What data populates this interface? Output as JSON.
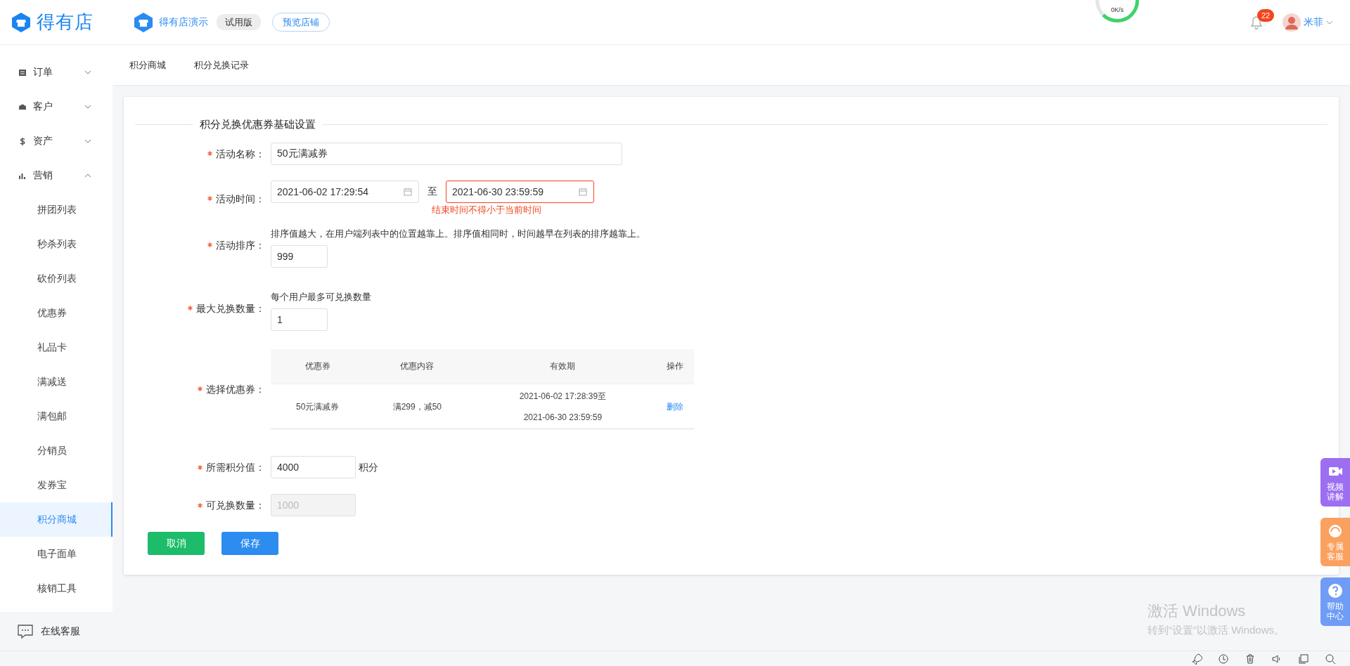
{
  "header": {
    "logo_text": "得有店",
    "store_name": "得有店演示",
    "plan_badge": "试用版",
    "preview_button": "预览店铺",
    "speed": "0K/s",
    "notifications": "22",
    "user": "米菲"
  },
  "tabs": [
    {
      "label": "积分商城"
    },
    {
      "label": "积分兑换记录"
    }
  ],
  "sidebar": {
    "items": [
      {
        "label": "订单",
        "expanded": false
      },
      {
        "label": "客户",
        "expanded": false
      },
      {
        "label": "资产",
        "expanded": false
      },
      {
        "label": "营销",
        "expanded": true,
        "children": [
          {
            "label": "拼团列表",
            "selected": false
          },
          {
            "label": "秒杀列表",
            "selected": false
          },
          {
            "label": "砍价列表",
            "selected": false
          },
          {
            "label": "优惠券",
            "selected": false
          },
          {
            "label": "礼品卡",
            "selected": false
          },
          {
            "label": "满减送",
            "selected": false
          },
          {
            "label": "满包邮",
            "selected": false
          },
          {
            "label": "分销员",
            "selected": false
          },
          {
            "label": "发券宝",
            "selected": false
          },
          {
            "label": "积分商城",
            "selected": true
          },
          {
            "label": "电子面单",
            "selected": false
          },
          {
            "label": "核销工具",
            "selected": false
          }
        ]
      }
    ],
    "support": "在线客服"
  },
  "form": {
    "section_title": "积分兑换优惠券基础设置",
    "fields": [
      {
        "kind": "text",
        "label": "活动名称：",
        "required": true,
        "value": "50元满减券"
      },
      {
        "kind": "daterange",
        "label": "活动时间：",
        "required": true,
        "start": "2021-06-02 17:29:54",
        "separator": "至",
        "end": "2021-06-30 23:59:59",
        "error": "结束时间不得小于当前时间"
      },
      {
        "kind": "hinted",
        "label": "活动排序：",
        "required": true,
        "hint": "排序值越大，在用户端列表中的位置越靠上。排序值相同时，时间越早在列表的排序越靠上。",
        "value": "999"
      },
      {
        "kind": "hinted",
        "label": "最大兑换数量：",
        "required": true,
        "hint": "每个用户最多可兑换数量",
        "value": "1"
      },
      {
        "kind": "table",
        "label": "选择优惠券：",
        "required": true,
        "columns": [
          "优惠券",
          "优惠内容",
          "有效期",
          "操作"
        ],
        "rows": [
          {
            "coupon": "50元满减券",
            "content": "满299，减50",
            "validity": [
              "2021-06-02 17:28:39至",
              "2021-06-30 23:59:59"
            ],
            "action": "删除"
          }
        ]
      },
      {
        "kind": "suffixed",
        "label": "所需积分值：",
        "required": true,
        "value": "4000",
        "suffix": "积分"
      },
      {
        "kind": "text",
        "label": "可兑换数量：",
        "required": true,
        "value": "1000",
        "disabled": true
      }
    ],
    "buttons": [
      {
        "kind": "cancel",
        "label": "取消"
      },
      {
        "kind": "save",
        "label": "保存"
      }
    ]
  },
  "side_widgets": [
    {
      "kind": "video",
      "label": "视频讲解",
      "color": "#9c6ef2"
    },
    {
      "kind": "service",
      "label": "专属客服",
      "color": "#fba15f"
    },
    {
      "kind": "help",
      "label": "帮助中心",
      "color": "#6f9cf6"
    }
  ],
  "activation_notice": {
    "title": "激活 Windows",
    "subtitle": "转到“设置”以激活 Windows。"
  }
}
